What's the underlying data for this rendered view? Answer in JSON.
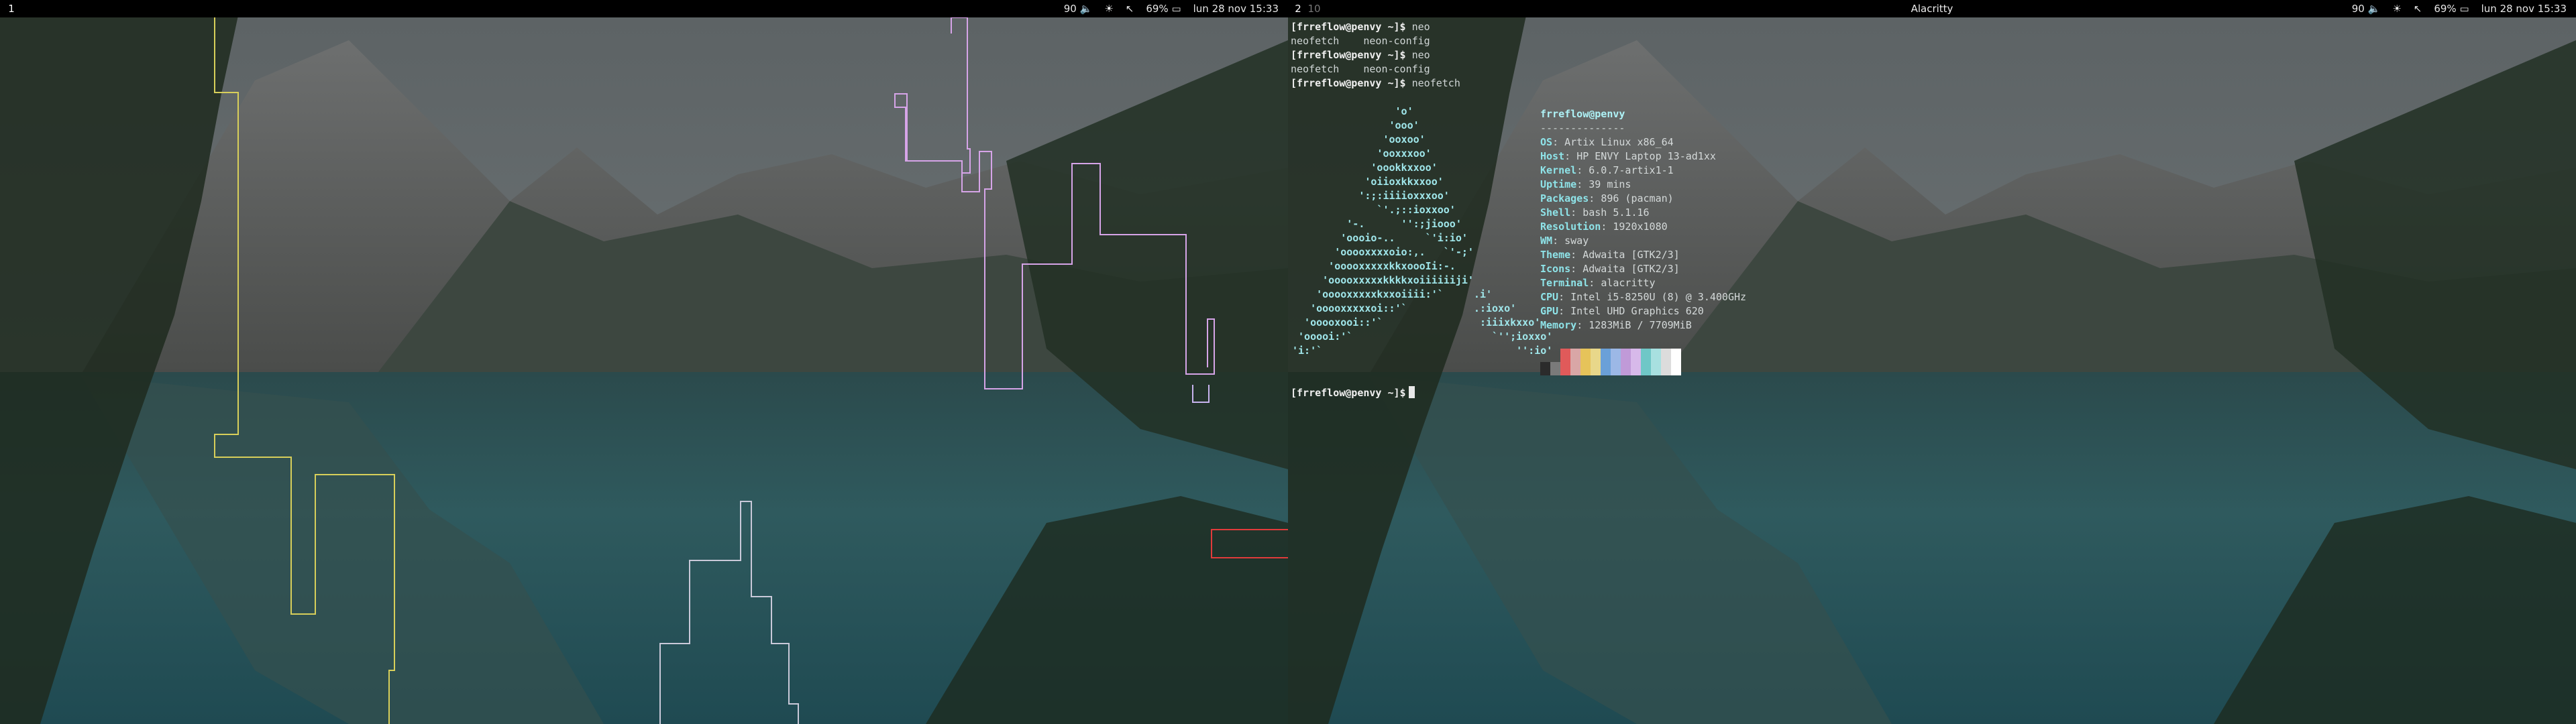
{
  "colors": {
    "bar_bg": "#000000",
    "yellow_line": "#d8cf5a",
    "violet_line": "#d6a4e8",
    "lilac_line": "#c9b4f0",
    "red_box": "#e23b3b",
    "ascii_cyan": "#9fe6ea"
  },
  "left_monitor": {
    "bar": {
      "workspaces": [
        {
          "label": "1",
          "active": true
        }
      ],
      "status": {
        "volume": "90 🔈",
        "brightness": "☀",
        "network": "↖",
        "battery": "69% ▭",
        "datetime": "lun 28 nov 15:33"
      }
    },
    "wallpaper": "mountain-lake"
  },
  "right_monitor": {
    "bar": {
      "workspaces": [
        {
          "label": "2",
          "active": true
        },
        {
          "label": "10",
          "active": false
        }
      ],
      "window_title": "Alacritty",
      "status": {
        "volume": "90 🔈",
        "brightness": "☀",
        "network": "↖",
        "battery": "69% ▭",
        "datetime": "lun 28 nov 15:33"
      }
    },
    "terminal": {
      "lines": [
        {
          "prompt": "[frreflow@penvy ~]$",
          "cmd": " neo"
        },
        {
          "prompt": "",
          "cmd": "neofetch    neon-config"
        },
        {
          "prompt": "[frreflow@penvy ~]$",
          "cmd": " neo"
        },
        {
          "prompt": "",
          "cmd": "neofetch    neon-config"
        },
        {
          "prompt": "[frreflow@penvy ~]$",
          "cmd": " neofetch"
        }
      ],
      "ascii_logo": "                 'o'\n                'ooo'\n               'ooxoo'\n              'ooxxxoo'\n             'oookkxxoo'\n            'oiioxkkxxoo'\n           ':;:iiiioxxxoo'\n              `'.;::ioxxoo'\n         '-.      '':;jiooo'\n        'oooio-..     `'i:io'\n       'ooooxxxxoio:,.   `'-;'\n      'ooooxxxxxkkxoooIi:-.\n     'ooooxxxxxkkkkxoiiiiiiji'\n    'ooooxxxxxkxxoiiii:'`     .i'\n   'ooooxxxxxoi::'`           .:ioxo'\n  'ooooxooi::'`                :iiixkxxo'\n 'ooooi:'`                       `'';ioxxo'\n'i:'`                                '':io'",
      "info": {
        "title": "frreflow@penvy",
        "separator": "--------------",
        "rows": [
          {
            "k": "OS",
            "v": "Artix Linux x86_64"
          },
          {
            "k": "Host",
            "v": "HP ENVY Laptop 13-ad1xx"
          },
          {
            "k": "Kernel",
            "v": "6.0.7-artix1-1"
          },
          {
            "k": "Uptime",
            "v": "39 mins"
          },
          {
            "k": "Packages",
            "v": "896 (pacman)"
          },
          {
            "k": "Shell",
            "v": "bash 5.1.16"
          },
          {
            "k": "Resolution",
            "v": "1920x1080"
          },
          {
            "k": "WM",
            "v": "sway"
          },
          {
            "k": "Theme",
            "v": "Adwaita [GTK2/3]"
          },
          {
            "k": "Icons",
            "v": "Adwaita [GTK2/3]"
          },
          {
            "k": "Terminal",
            "v": "alacritty"
          },
          {
            "k": "CPU",
            "v": "Intel i5-8250U (8) @ 3.400GHz"
          },
          {
            "k": "GPU",
            "v": "Intel UHD Graphics 620"
          },
          {
            "k": "Memory",
            "v": "1283MiB / 7709MiB"
          }
        ]
      },
      "swatches": [
        "#2b2b2b",
        "#7a7a7a",
        "#e05a5a",
        "#d9a6a6",
        "#e6c35a",
        "#e8d78a",
        "#6aa0d8",
        "#9cb8e6",
        "#c09ad8",
        "#d7b9ea",
        "#6fc7c7",
        "#a8e0e0",
        "#dcdcdc",
        "#ffffff"
      ],
      "final_prompt": "[frreflow@penvy ~]$"
    },
    "wallpaper": "mountain-lake"
  }
}
